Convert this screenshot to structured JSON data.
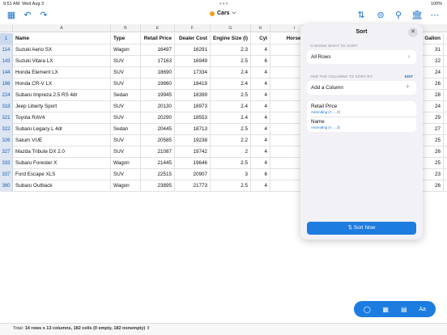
{
  "status_bar": {
    "time": "9:51 AM",
    "date": "Wed Aug 3",
    "battery": "100%"
  },
  "toolbar": {
    "document_title": "Cars",
    "doc_color": "#f0a020"
  },
  "columns": {
    "letters": [
      "A",
      "B",
      "E",
      "F",
      "G",
      "H",
      "I"
    ],
    "headers": [
      "Name",
      "Type",
      "Retail Price",
      "Dealer Cost",
      "Engine Size (l)",
      "Cyl",
      "Horsepower",
      "Gallon"
    ],
    "header_row_number": "1"
  },
  "rows": [
    {
      "num": "114",
      "name": "Suzuki Aerio SX",
      "type": "Wagon",
      "retail": "16497",
      "dealer": "16291",
      "engine": "2.3",
      "cyl": "4",
      "gallon": "31"
    },
    {
      "num": "143",
      "name": "Suzuki Vitara LX",
      "type": "SUV",
      "retail": "17163",
      "dealer": "16949",
      "engine": "2.5",
      "cyl": "6",
      "gallon": "22"
    },
    {
      "num": "144",
      "name": "Honda Element LX",
      "type": "SUV",
      "retail": "18690",
      "dealer": "17334",
      "engine": "2.4",
      "cyl": "4",
      "gallon": "24"
    },
    {
      "num": "186",
      "name": "Honda CR-V LX",
      "type": "SUV",
      "retail": "19860",
      "dealer": "18419",
      "engine": "2.4",
      "cyl": "4",
      "gallon": "26"
    },
    {
      "num": "224",
      "name": "Subaru Impreza 2.5 RS 4dr",
      "type": "Sedan",
      "retail": "19945",
      "dealer": "18399",
      "engine": "2.5",
      "cyl": "4",
      "gallon": "28"
    },
    {
      "num": "318",
      "name": "Jeep Liberty Sport",
      "type": "SUV",
      "retail": "20130",
      "dealer": "18973",
      "engine": "2.4",
      "cyl": "4",
      "gallon": "24"
    },
    {
      "num": "321",
      "name": "Toyota RAV4",
      "type": "SUV",
      "retail": "20290",
      "dealer": "18553",
      "engine": "2.4",
      "cyl": "4",
      "gallon": "29"
    },
    {
      "num": "322",
      "name": "Subaru Legacy L 4dr",
      "type": "Sedan",
      "retail": "20445",
      "dealer": "18713",
      "engine": "2.5",
      "cyl": "4",
      "gallon": "27"
    },
    {
      "num": "326",
      "name": "Saturn VUE",
      "type": "SUV",
      "retail": "20585",
      "dealer": "19238",
      "engine": "2.2",
      "cyl": "4",
      "gallon": "25"
    },
    {
      "num": "327",
      "name": "Mazda Tribute DX 2.0",
      "type": "SUV",
      "retail": "21087",
      "dealer": "19742",
      "engine": "2",
      "cyl": "4",
      "gallon": "26"
    },
    {
      "num": "333",
      "name": "Subaru Forester X",
      "type": "Wagon",
      "retail": "21445",
      "dealer": "19646",
      "engine": "2.5",
      "cyl": "4",
      "gallon": "25"
    },
    {
      "num": "337",
      "name": "Ford Escape XLS",
      "type": "SUV",
      "retail": "22515",
      "dealer": "20907",
      "engine": "3",
      "cyl": "6",
      "gallon": "23"
    },
    {
      "num": "360",
      "name": "Subaru Outback",
      "type": "Wagon",
      "retail": "23895",
      "dealer": "21773",
      "engine": "2.5",
      "cyl": "4",
      "gallon": "26"
    }
  ],
  "sort_panel": {
    "title": "Sort",
    "choose_label": "CHOOSE WHAT TO SORT:",
    "scope_value": "All Rows",
    "columns_label": "AND THE COLUMNS TO SORT BY:",
    "edit_label": "EDIT",
    "add_column_label": "Add a Column",
    "criteria": [
      {
        "column": "Retail Price",
        "order": "Ascending (A → Z)"
      },
      {
        "column": "Name",
        "order": "Ascending (A → Z)"
      }
    ],
    "sort_button": "Sort Now"
  },
  "footer": {
    "prefix": "Total:",
    "summary": "14 rows x 13 columns, 182 cells (0 empty, 182 nonempty)"
  },
  "accent_color": "#1d7ce0"
}
